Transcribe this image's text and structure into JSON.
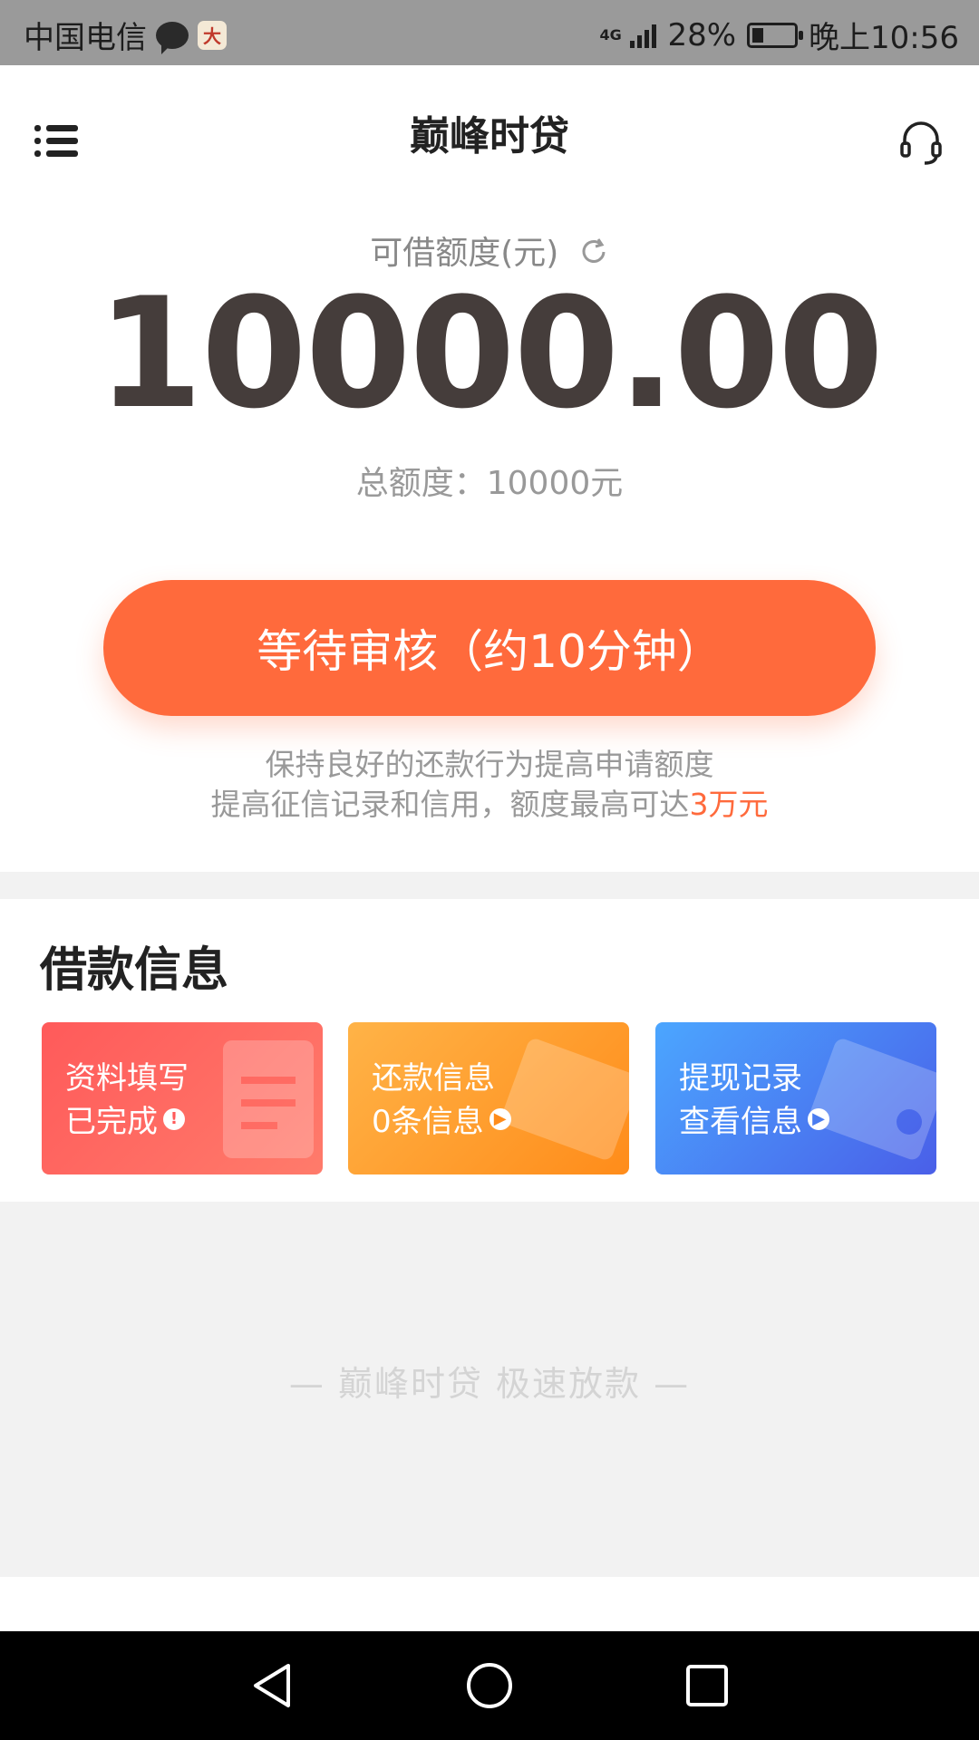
{
  "status_bar": {
    "carrier": "中国电信",
    "app_badge": "大",
    "network": "4G",
    "battery_percent": "28%",
    "battery_level": 0.28,
    "time": "晚上10:56"
  },
  "header": {
    "title": "巅峰时贷"
  },
  "quota": {
    "label": "可借额度(元)",
    "amount": "10000.00",
    "total": "总额度：10000元"
  },
  "action": {
    "button_label": "等待审核（约10分钟）"
  },
  "tip": {
    "line1": "保持良好的还款行为提高申请额度",
    "line2_prefix": "提高征信记录和信用，额度最高可达",
    "line2_highlight": "3万元"
  },
  "loan_info": {
    "title": "借款信息",
    "cards": [
      {
        "line1": "资料填写",
        "line2": "已完成",
        "badge": "!"
      },
      {
        "line1": "还款信息",
        "line2": "0条信息",
        "badge": "▶"
      },
      {
        "line1": "提现记录",
        "line2": "查看信息",
        "badge": "▶"
      }
    ]
  },
  "footer": {
    "slogan": "— 巅峰时贷  极速放款 —"
  },
  "icons": {
    "menu": "menu-icon",
    "support": "headset-icon",
    "refresh": "refresh-icon",
    "back": "back-icon",
    "home": "home-icon",
    "recent": "recent-apps-icon"
  },
  "colors": {
    "accent": "#ff6a3c",
    "card_red": "#ff5a5a",
    "card_orange": "#ff8c1a",
    "card_blue": "#4a7cf0"
  }
}
